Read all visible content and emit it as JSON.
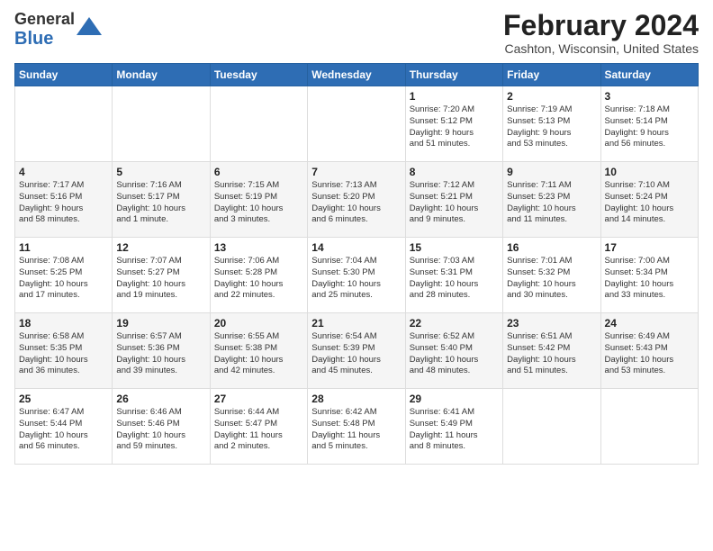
{
  "header": {
    "logo_general": "General",
    "logo_blue": "Blue",
    "month_year": "February 2024",
    "location": "Cashton, Wisconsin, United States"
  },
  "days_of_week": [
    "Sunday",
    "Monday",
    "Tuesday",
    "Wednesday",
    "Thursday",
    "Friday",
    "Saturday"
  ],
  "weeks": [
    [
      {
        "day": "",
        "info": ""
      },
      {
        "day": "",
        "info": ""
      },
      {
        "day": "",
        "info": ""
      },
      {
        "day": "",
        "info": ""
      },
      {
        "day": "1",
        "info": "Sunrise: 7:20 AM\nSunset: 5:12 PM\nDaylight: 9 hours\nand 51 minutes."
      },
      {
        "day": "2",
        "info": "Sunrise: 7:19 AM\nSunset: 5:13 PM\nDaylight: 9 hours\nand 53 minutes."
      },
      {
        "day": "3",
        "info": "Sunrise: 7:18 AM\nSunset: 5:14 PM\nDaylight: 9 hours\nand 56 minutes."
      }
    ],
    [
      {
        "day": "4",
        "info": "Sunrise: 7:17 AM\nSunset: 5:16 PM\nDaylight: 9 hours\nand 58 minutes."
      },
      {
        "day": "5",
        "info": "Sunrise: 7:16 AM\nSunset: 5:17 PM\nDaylight: 10 hours\nand 1 minute."
      },
      {
        "day": "6",
        "info": "Sunrise: 7:15 AM\nSunset: 5:19 PM\nDaylight: 10 hours\nand 3 minutes."
      },
      {
        "day": "7",
        "info": "Sunrise: 7:13 AM\nSunset: 5:20 PM\nDaylight: 10 hours\nand 6 minutes."
      },
      {
        "day": "8",
        "info": "Sunrise: 7:12 AM\nSunset: 5:21 PM\nDaylight: 10 hours\nand 9 minutes."
      },
      {
        "day": "9",
        "info": "Sunrise: 7:11 AM\nSunset: 5:23 PM\nDaylight: 10 hours\nand 11 minutes."
      },
      {
        "day": "10",
        "info": "Sunrise: 7:10 AM\nSunset: 5:24 PM\nDaylight: 10 hours\nand 14 minutes."
      }
    ],
    [
      {
        "day": "11",
        "info": "Sunrise: 7:08 AM\nSunset: 5:25 PM\nDaylight: 10 hours\nand 17 minutes."
      },
      {
        "day": "12",
        "info": "Sunrise: 7:07 AM\nSunset: 5:27 PM\nDaylight: 10 hours\nand 19 minutes."
      },
      {
        "day": "13",
        "info": "Sunrise: 7:06 AM\nSunset: 5:28 PM\nDaylight: 10 hours\nand 22 minutes."
      },
      {
        "day": "14",
        "info": "Sunrise: 7:04 AM\nSunset: 5:30 PM\nDaylight: 10 hours\nand 25 minutes."
      },
      {
        "day": "15",
        "info": "Sunrise: 7:03 AM\nSunset: 5:31 PM\nDaylight: 10 hours\nand 28 minutes."
      },
      {
        "day": "16",
        "info": "Sunrise: 7:01 AM\nSunset: 5:32 PM\nDaylight: 10 hours\nand 30 minutes."
      },
      {
        "day": "17",
        "info": "Sunrise: 7:00 AM\nSunset: 5:34 PM\nDaylight: 10 hours\nand 33 minutes."
      }
    ],
    [
      {
        "day": "18",
        "info": "Sunrise: 6:58 AM\nSunset: 5:35 PM\nDaylight: 10 hours\nand 36 minutes."
      },
      {
        "day": "19",
        "info": "Sunrise: 6:57 AM\nSunset: 5:36 PM\nDaylight: 10 hours\nand 39 minutes."
      },
      {
        "day": "20",
        "info": "Sunrise: 6:55 AM\nSunset: 5:38 PM\nDaylight: 10 hours\nand 42 minutes."
      },
      {
        "day": "21",
        "info": "Sunrise: 6:54 AM\nSunset: 5:39 PM\nDaylight: 10 hours\nand 45 minutes."
      },
      {
        "day": "22",
        "info": "Sunrise: 6:52 AM\nSunset: 5:40 PM\nDaylight: 10 hours\nand 48 minutes."
      },
      {
        "day": "23",
        "info": "Sunrise: 6:51 AM\nSunset: 5:42 PM\nDaylight: 10 hours\nand 51 minutes."
      },
      {
        "day": "24",
        "info": "Sunrise: 6:49 AM\nSunset: 5:43 PM\nDaylight: 10 hours\nand 53 minutes."
      }
    ],
    [
      {
        "day": "25",
        "info": "Sunrise: 6:47 AM\nSunset: 5:44 PM\nDaylight: 10 hours\nand 56 minutes."
      },
      {
        "day": "26",
        "info": "Sunrise: 6:46 AM\nSunset: 5:46 PM\nDaylight: 10 hours\nand 59 minutes."
      },
      {
        "day": "27",
        "info": "Sunrise: 6:44 AM\nSunset: 5:47 PM\nDaylight: 11 hours\nand 2 minutes."
      },
      {
        "day": "28",
        "info": "Sunrise: 6:42 AM\nSunset: 5:48 PM\nDaylight: 11 hours\nand 5 minutes."
      },
      {
        "day": "29",
        "info": "Sunrise: 6:41 AM\nSunset: 5:49 PM\nDaylight: 11 hours\nand 8 minutes."
      },
      {
        "day": "",
        "info": ""
      },
      {
        "day": "",
        "info": ""
      }
    ]
  ]
}
